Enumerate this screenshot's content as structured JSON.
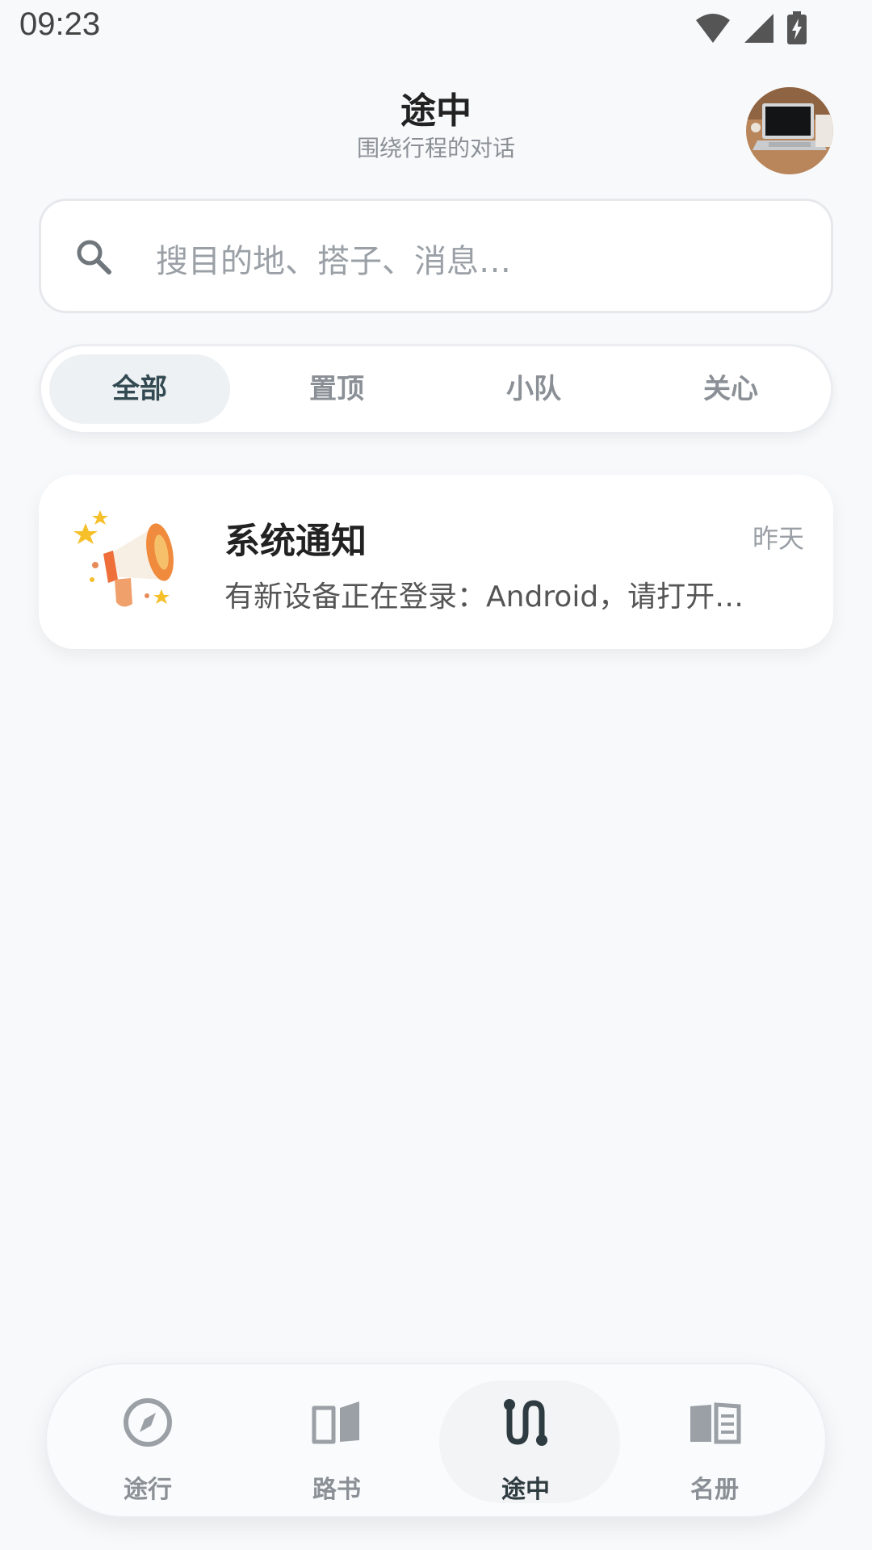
{
  "status_bar": {
    "time": "09:23",
    "icons": [
      "wifi-icon",
      "signal-icon",
      "battery-charging-icon"
    ]
  },
  "header": {
    "title": "途中",
    "subtitle": "围绕行程的对话",
    "avatar_icon": "laptop-photo"
  },
  "search": {
    "placeholder": "搜目的地、搭子、消息…",
    "icon": "search-icon"
  },
  "tabs": [
    {
      "label": "全部",
      "active": true
    },
    {
      "label": "置顶",
      "active": false
    },
    {
      "label": "小队",
      "active": false
    },
    {
      "label": "关心",
      "active": false
    }
  ],
  "messages": [
    {
      "title": "系统通知",
      "time": "昨天",
      "preview": "有新设备正在登录：Android，请打开…",
      "icon": "megaphone-icon"
    }
  ],
  "bottom_nav": [
    {
      "label": "途行",
      "icon": "compass-icon",
      "active": false
    },
    {
      "label": "路书",
      "icon": "book-icon",
      "active": false
    },
    {
      "label": "途中",
      "icon": "route-icon",
      "active": true
    },
    {
      "label": "名册",
      "icon": "roster-icon",
      "active": false
    }
  ],
  "colors": {
    "background": "#f8f9fb",
    "active_tab_bg": "#eef1f3",
    "active_text": "#2e3b40",
    "muted_text": "#8a9096",
    "megaphone_orange": "#f08a3c"
  }
}
